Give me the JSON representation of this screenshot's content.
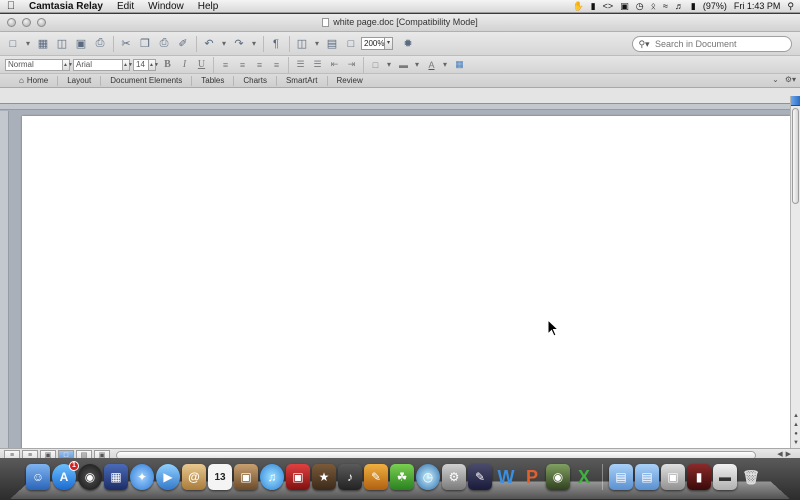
{
  "menubar": {
    "app_name": "Camtasia Relay",
    "items": [
      "Edit",
      "Window",
      "Help"
    ],
    "battery": "(97%)",
    "clock": "Fri 1:43 PM"
  },
  "window": {
    "title": "white page.doc [Compatibility Mode]"
  },
  "toolbar": {
    "zoom": "200%",
    "search_placeholder": "Search in Document"
  },
  "formatting": {
    "style": "Normal",
    "font": "Arial",
    "size": "14",
    "bold": "B",
    "italic": "I",
    "underline": "U"
  },
  "ribbon": {
    "tabs": [
      "Home",
      "Layout",
      "Document Elements",
      "Tables",
      "Charts",
      "SmartArt",
      "Review"
    ]
  },
  "dock": {
    "badge_count": "1",
    "calendar_day": "13"
  },
  "colors": {
    "accent": "#2c6fc9",
    "doc_background": "#a9b0b9",
    "page": "#ffffff"
  }
}
